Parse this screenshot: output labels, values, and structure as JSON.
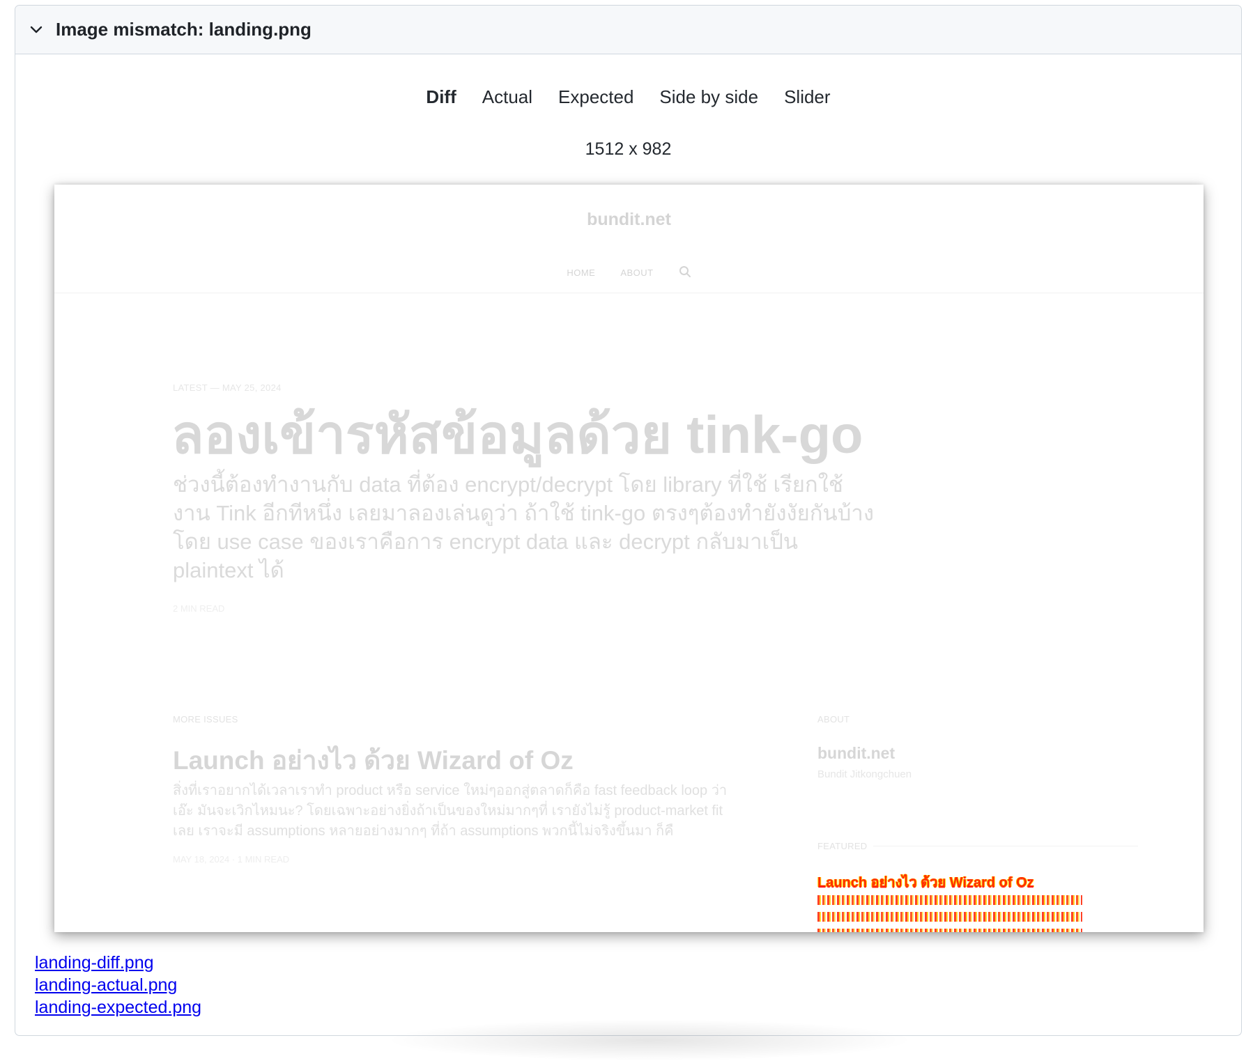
{
  "panel": {
    "title": "Image mismatch: landing.png"
  },
  "tabs": [
    {
      "label": "Diff",
      "active": true
    },
    {
      "label": "Actual",
      "active": false
    },
    {
      "label": "Expected",
      "active": false
    },
    {
      "label": "Side by side",
      "active": false
    },
    {
      "label": "Slider",
      "active": false
    }
  ],
  "dimensions": "1512 x 982",
  "screenshot": {
    "site_title": "bundit.net",
    "nav": [
      "HOME",
      "ABOUT"
    ],
    "latest_meta": "LATEST — MAY 25, 2024",
    "hero_title": "ลองเข้ารหัสข้อมูลด้วย tink-go",
    "hero_excerpt": "ช่วงนี้ต้องทำงานกับ data ที่ต้อง encrypt/decrypt โดย library ที่ใช้ เรียกใช้งาน Tink อีกทีหนึ่ง เลยมาลองเล่นดูว่า ถ้าใช้ tink-go ตรงๆต้องทำยังงัยกันบ้าง โดย use case ของเราคือการ encrypt data และ decrypt กลับมาเป็น plaintext ได้",
    "hero_read": "2 MIN READ",
    "more_label": "MORE ISSUES",
    "post_title": "Launch อย่างไว ด้วย Wizard of Oz",
    "post_excerpt": "สิ่งที่เราอยากได้เวลาเราทำ product หรือ service ใหม่ๆออกสู่ตลาดก็คือ fast feedback loop ว่าเอ๊ะ มันจะเวิกไหมนะ? โดยเฉพาะอย่างยิ่งถ้าเป็นของใหม่มากๆที่ เรายังไม่รู้ product-market fit เลย เราจะมี assumptions หลายอย่างมากๆ ที่ถ้า assumptions พวกนี้ไม่จริงขึ้นมา ก็คื",
    "post_meta": "MAY 18, 2024 · 1 MIN READ",
    "about_label": "ABOUT",
    "about_name": "bundit.net",
    "about_author": "Bundit Jitkongchuen",
    "featured_label": "FEATURED",
    "featured_title": "Launch อย่างไว ด้วย Wizard of Oz"
  },
  "links": [
    "landing-diff.png",
    "landing-actual.png",
    "landing-expected.png"
  ],
  "colors": {
    "diff_highlight": "#ff2a00",
    "link": "#0000ee",
    "header_bg": "#f6f8fa",
    "border": "#d0d7de"
  }
}
